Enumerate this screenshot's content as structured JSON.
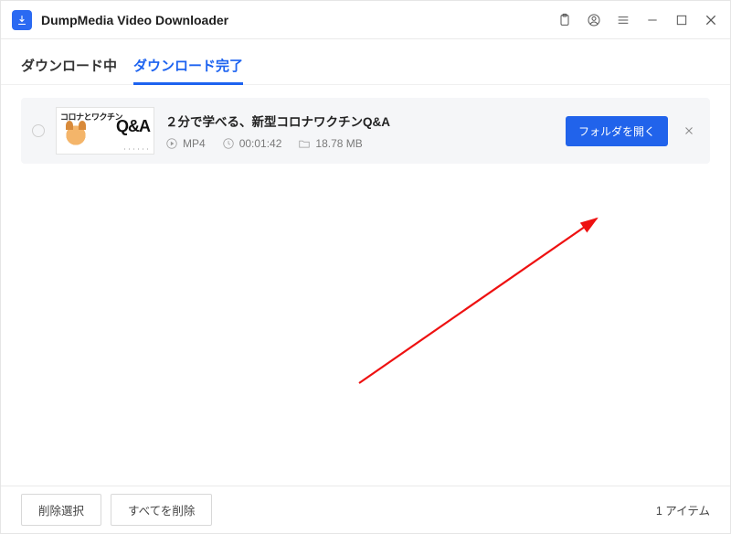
{
  "app": {
    "title": "DumpMedia Video Downloader"
  },
  "tabs": {
    "downloading": "ダウンロード中",
    "completed": "ダウンロード完了"
  },
  "item": {
    "title": "２分で学べる、新型コロナワクチンQ&A",
    "format": "MP4",
    "duration": "00:01:42",
    "filesize": "18.78 MB",
    "thumb_top": "コロナとワクチン",
    "thumb_qa": "Q&A",
    "open_folder_label": "フォルダを開く"
  },
  "footer": {
    "delete_selected": "削除選択",
    "delete_all": "すべてを削除",
    "item_count": "1 アイテム"
  }
}
